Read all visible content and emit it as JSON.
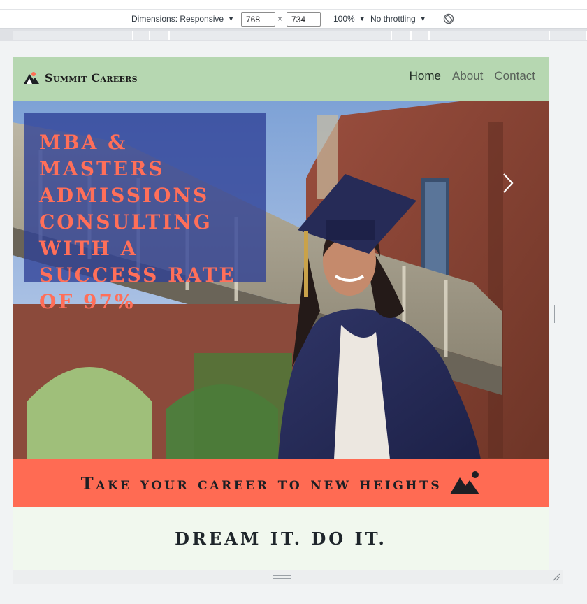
{
  "devtools": {
    "dimensions_label": "Dimensions: Responsive",
    "width_value": "768",
    "height_value": "734",
    "times_sign": "×",
    "zoom_label": "100%",
    "throttling_label": "No throttling",
    "caret": "▼"
  },
  "site": {
    "brand_name": "Summit Careers",
    "nav": [
      {
        "label": "Home",
        "active": true
      },
      {
        "label": "About",
        "active": false
      },
      {
        "label": "Contact",
        "active": false
      }
    ],
    "hero_title": "MBA & Masters Admissions Consulting with a Success Rate of 97%",
    "tagline": "Take your career to new heights",
    "dream": "DREAM IT. DO IT."
  },
  "colors": {
    "nav_bg": "#b6d7b1",
    "accent": "#ff6b53",
    "hero_card_bg": "#2e4096",
    "hero_text": "#ff6f59",
    "section_bg": "#f1f8ee"
  }
}
